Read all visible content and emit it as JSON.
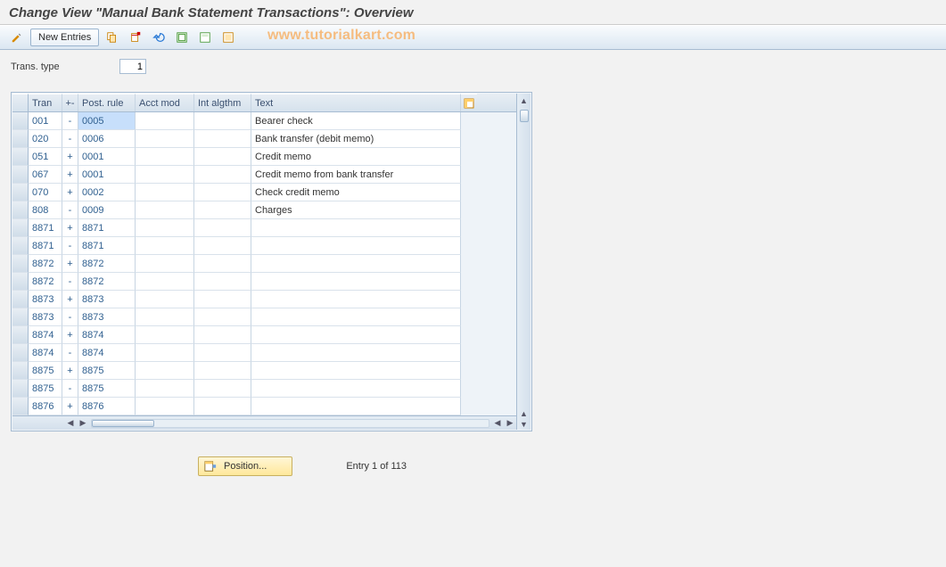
{
  "title": "Change View \"Manual Bank Statement Transactions\": Overview",
  "watermark": "www.tutorialkart.com",
  "toolbar": {
    "toggle_label": "",
    "new_entries_label": "New Entries"
  },
  "field": {
    "trans_type_label": "Trans. type",
    "trans_type_value": "1"
  },
  "grid": {
    "headers": {
      "sel": "",
      "tran": "Tran",
      "sign": "+-",
      "post": "Post. rule",
      "acct": "Acct mod",
      "int": "Int algthm",
      "txt": "Text"
    },
    "rows": [
      {
        "tran": "001",
        "sign": "-",
        "post": "0005",
        "acct": "",
        "int": "",
        "txt": "Bearer check",
        "sel": true
      },
      {
        "tran": "020",
        "sign": "-",
        "post": "0006",
        "acct": "",
        "int": "",
        "txt": "Bank transfer (debit memo)"
      },
      {
        "tran": "051",
        "sign": "+",
        "post": "0001",
        "acct": "",
        "int": "",
        "txt": "Credit memo"
      },
      {
        "tran": "067",
        "sign": "+",
        "post": "0001",
        "acct": "",
        "int": "",
        "txt": "Credit memo from bank transfer"
      },
      {
        "tran": "070",
        "sign": "+",
        "post": "0002",
        "acct": "",
        "int": "",
        "txt": "Check credit memo"
      },
      {
        "tran": "808",
        "sign": "-",
        "post": "0009",
        "acct": "",
        "int": "",
        "txt": "Charges"
      },
      {
        "tran": "8871",
        "sign": "+",
        "post": "8871",
        "acct": "",
        "int": "",
        "txt": ""
      },
      {
        "tran": "8871",
        "sign": "-",
        "post": "8871",
        "acct": "",
        "int": "",
        "txt": ""
      },
      {
        "tran": "8872",
        "sign": "+",
        "post": "8872",
        "acct": "",
        "int": "",
        "txt": ""
      },
      {
        "tran": "8872",
        "sign": "-",
        "post": "8872",
        "acct": "",
        "int": "",
        "txt": ""
      },
      {
        "tran": "8873",
        "sign": "+",
        "post": "8873",
        "acct": "",
        "int": "",
        "txt": ""
      },
      {
        "tran": "8873",
        "sign": "-",
        "post": "8873",
        "acct": "",
        "int": "",
        "txt": ""
      },
      {
        "tran": "8874",
        "sign": "+",
        "post": "8874",
        "acct": "",
        "int": "",
        "txt": ""
      },
      {
        "tran": "8874",
        "sign": "-",
        "post": "8874",
        "acct": "",
        "int": "",
        "txt": ""
      },
      {
        "tran": "8875",
        "sign": "+",
        "post": "8875",
        "acct": "",
        "int": "",
        "txt": ""
      },
      {
        "tran": "8875",
        "sign": "-",
        "post": "8875",
        "acct": "",
        "int": "",
        "txt": ""
      },
      {
        "tran": "8876",
        "sign": "+",
        "post": "8876",
        "acct": "",
        "int": "",
        "txt": ""
      }
    ]
  },
  "footer": {
    "position_label": "Position...",
    "entry_status": "Entry 1 of 113"
  }
}
